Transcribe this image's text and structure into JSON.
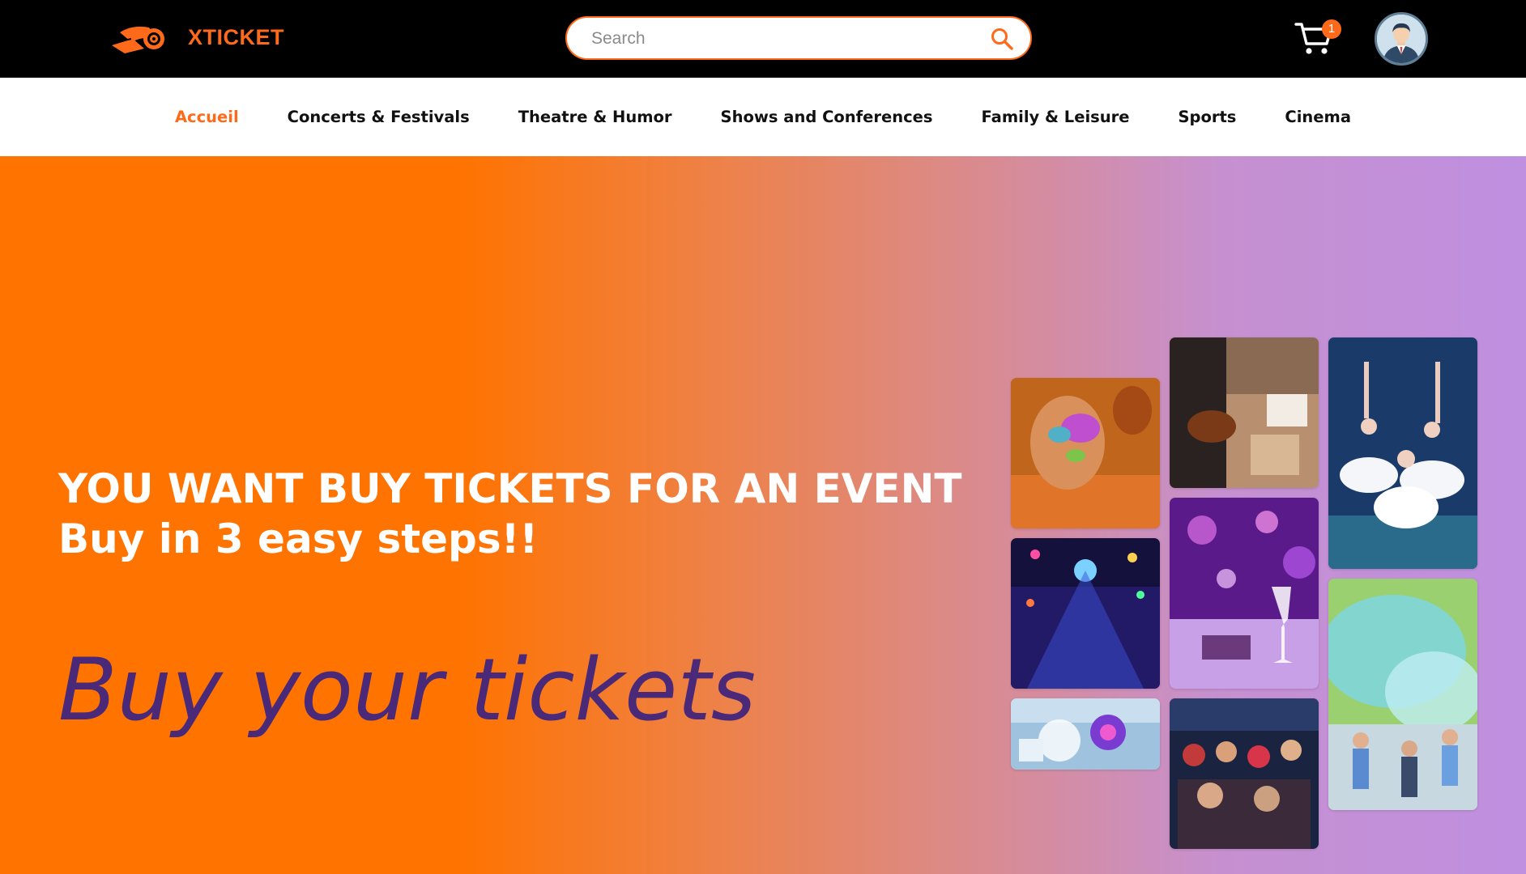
{
  "brand": {
    "name": "XTICKET",
    "accent_color": "#FF6A1A"
  },
  "search": {
    "placeholder": "Search",
    "value": ""
  },
  "cart": {
    "count": "1",
    "icon": "cart-icon"
  },
  "user": {
    "icon": "avatar-icon"
  },
  "nav": {
    "items": [
      {
        "label": "Accueil",
        "active": true
      },
      {
        "label": "Concerts & Festivals",
        "active": false
      },
      {
        "label": "Theatre & Humor",
        "active": false
      },
      {
        "label": "Shows and Conferences",
        "active": false
      },
      {
        "label": "Family & Leisure",
        "active": false
      },
      {
        "label": "Sports",
        "active": false
      },
      {
        "label": "Cinema",
        "active": false
      }
    ]
  },
  "hero": {
    "headline_line1": "YOU WANT BUY TICKETS FOR AN EVENT",
    "headline_line2": "Buy in 3 easy steps!!",
    "tagline": "Buy your tickets",
    "gradient_start": "#FF7300",
    "gradient_end": "#BF8FE0",
    "tagline_color": "#4A2A78"
  }
}
